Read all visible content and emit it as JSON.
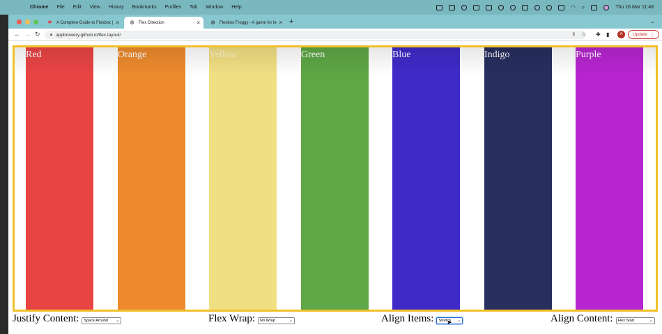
{
  "menubar": {
    "app": "Chrome",
    "items": [
      "File",
      "Edit",
      "View",
      "History",
      "Bookmarks",
      "Profiles",
      "Tab",
      "Window",
      "Help"
    ],
    "clock": "Thu 16 Mar  11:48"
  },
  "tabs": [
    {
      "title": "A Complete Guide to Flexbox |",
      "icon": "css-tricks-icon"
    },
    {
      "title": "Flex Direction",
      "icon": "globe-icon",
      "active": true
    },
    {
      "title": "Flexbox Froggy - A game for le",
      "icon": "globe-icon"
    }
  ],
  "address": {
    "url": "appbrewery.github.io/flex-layout/"
  },
  "update_label": "Update",
  "avatar_letter": "A",
  "boxes": [
    {
      "label": "Red",
      "color": "#e84444"
    },
    {
      "label": "Orange",
      "color": "#ec8a2d"
    },
    {
      "label": "Yellow",
      "color": "#f1df83"
    },
    {
      "label": "Green",
      "color": "#5ea646"
    },
    {
      "label": "Blue",
      "color": "#3f2ac7"
    },
    {
      "label": "Indigo",
      "color": "#282e5e"
    },
    {
      "label": "Purple",
      "color": "#b625cf"
    }
  ],
  "controls": {
    "justify": {
      "label": "Justify Content:",
      "value": "Space Around"
    },
    "wrap": {
      "label": "Flex Wrap:",
      "value": "No Wrap"
    },
    "align_items": {
      "label": "Align Items:",
      "value": "Stretch"
    },
    "align_content": {
      "label": "Align Content:",
      "value": "Flex Start"
    }
  },
  "colors": {
    "container_border": "#f0c12a"
  }
}
